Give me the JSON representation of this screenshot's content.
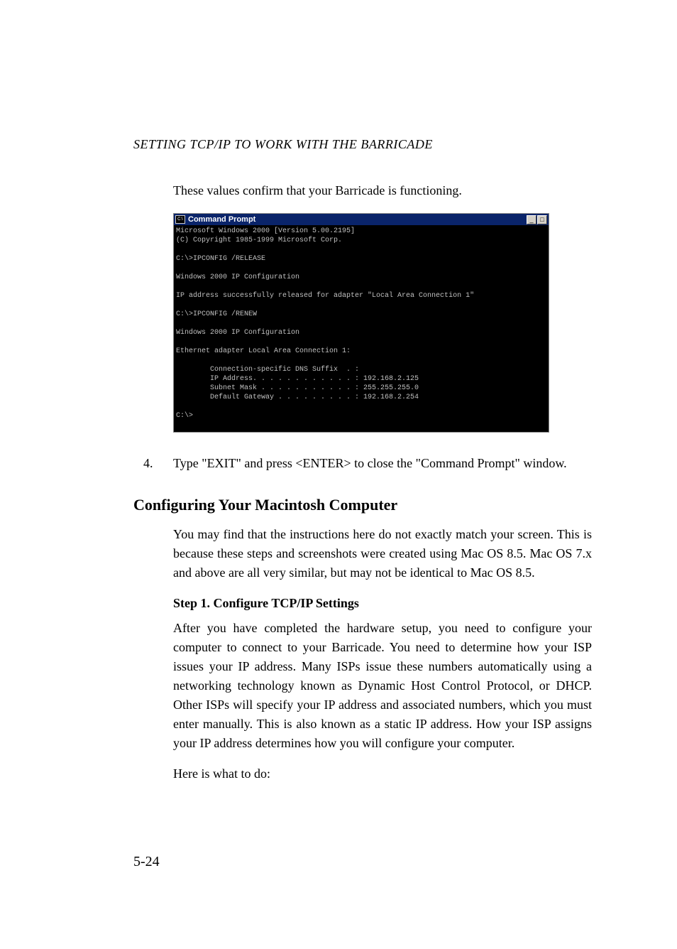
{
  "header": "SETTING TCP/IP TO WORK WITH THE BARRICADE",
  "intro": "These values confirm that your Barricade is functioning.",
  "cmd": {
    "title": "Command Prompt",
    "minimize": "_",
    "maximize": "□",
    "body": "Microsoft Windows 2000 [Version 5.00.2195]\n(C) Copyright 1985-1999 Microsoft Corp.\n\nC:\\>IPCONFIG /RELEASE\n\nWindows 2000 IP Configuration\n\nIP address successfully released for adapter \"Local Area Connection 1\"\n\nC:\\>IPCONFIG /RENEW\n\nWindows 2000 IP Configuration\n\nEthernet adapter Local Area Connection 1:\n\n        Connection-specific DNS Suffix  . :\n        IP Address. . . . . . . . . . . . : 192.168.2.125\n        Subnet Mask . . . . . . . . . . . : 255.255.255.0\n        Default Gateway . . . . . . . . . : 192.168.2.254\n\nC:\\>\n"
  },
  "step4": {
    "num": "4.",
    "text": "Type \"EXIT\" and press <ENTER> to close the \"Command Prompt\" window."
  },
  "section_heading": "Configuring Your Macintosh Computer",
  "mac_para": "You may find that the instructions here do not exactly match your screen. This is because these steps and screenshots were created using Mac OS 8.5. Mac OS 7.x and above are all very similar, but may not be identical to Mac OS 8.5.",
  "step_heading": "Step 1. Configure TCP/IP Settings",
  "tcpip_para": "After you have completed the hardware setup, you need to configure your computer to connect to your Barricade. You need to determine how your ISP issues your IP address. Many ISPs issue these numbers automatically using a networking technology known as Dynamic Host Control Protocol, or DHCP. Other ISPs will specify your IP address and associated numbers, which you must enter manually. This is also known as a static IP address. How your ISP assigns your IP address determines how you will configure your computer.",
  "closing": "Here is what to do:",
  "page_number": "5-24"
}
